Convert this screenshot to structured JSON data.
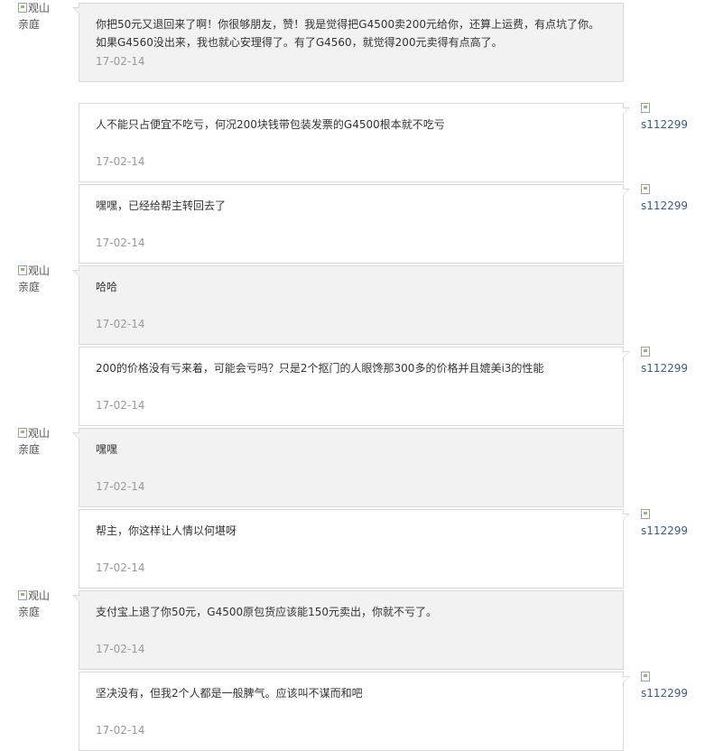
{
  "messages": [
    {
      "side": "left",
      "user": "观山\n亲庭",
      "text": "你把50元又退回来了啊！你很够朋友，赞！我是觉得把G4500卖200元给你，还算上运费，有点坑了你。如果G4560没出来，我也就心安理得了。有了G4560，就觉得200元卖得有点高了。",
      "date": "17-02-14"
    },
    {
      "side": "right",
      "user": "s112299",
      "text": "人不能只占便宜不吃亏，何况200块钱带包装发票的G4500根本就不吃亏",
      "date": "17-02-14"
    },
    {
      "side": "right",
      "user": "s112299",
      "text": "嘿嘿，已经给帮主转回去了",
      "date": "17-02-14"
    },
    {
      "side": "left",
      "user": "观山\n亲庭",
      "text": "哈哈",
      "date": "17-02-14"
    },
    {
      "side": "right",
      "user": "s112299",
      "text": "200的价格没有亏来着，可能会亏吗？只是2个抠门的人眼馋那300多的价格并且媲美i3的性能",
      "date": "17-02-14"
    },
    {
      "side": "left",
      "user": "观山\n亲庭",
      "text": "嘿嘿",
      "date": "17-02-14"
    },
    {
      "side": "right",
      "user": "s112299",
      "text": "帮主，你这样让人情以何堪呀",
      "date": "17-02-14"
    },
    {
      "side": "left",
      "user": "观山\n亲庭",
      "text": "支付宝上退了你50元，G4500原包货应该能150元卖出，你就不亏了。",
      "date": "17-02-14"
    },
    {
      "side": "right",
      "user": "s112299",
      "text": "坚决没有，但我2个人都是一般脾气。应该叫不谋而和吧",
      "date": "17-02-14"
    }
  ],
  "colors": {
    "left_bubble": "#f2f2f2",
    "right_bubble": "#ffffff",
    "border": "#d9d9d9",
    "date": "#999999"
  }
}
